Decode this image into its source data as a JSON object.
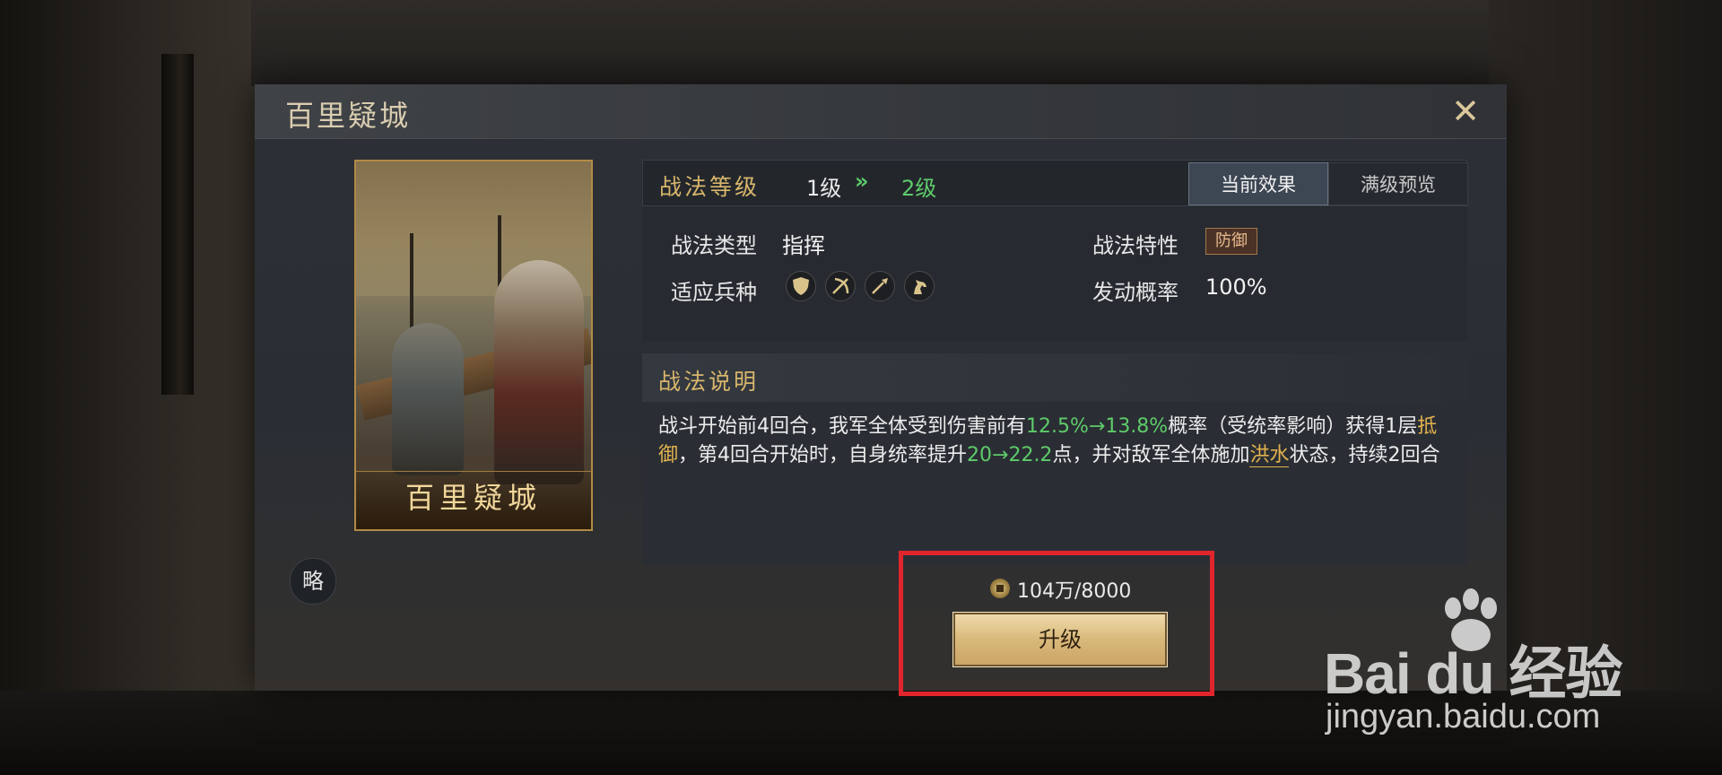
{
  "dialog": {
    "title": "百里疑城",
    "close_icon": "close-x-icon"
  },
  "card": {
    "name": "百里疑城"
  },
  "abbr_button": "略",
  "level": {
    "label": "战法等级",
    "current": "1级",
    "arrow": "»",
    "next": "2级",
    "tabs": [
      {
        "label": "当前效果",
        "active": true
      },
      {
        "label": "满级预览",
        "active": false
      }
    ]
  },
  "attributes": {
    "type_label": "战法类型",
    "type_value": "指挥",
    "trait_label": "战法特性",
    "trait_value": "防御",
    "units_label": "适应兵种",
    "units": [
      "shield-icon",
      "bow-icon",
      "spear-icon",
      "horse-icon"
    ],
    "rate_label": "发动概率",
    "rate_value": "100%"
  },
  "description": {
    "title": "战法说明",
    "seg1": "战斗开始前4回合，我军全体受到伤害前有",
    "val1": "12.5%→13.8%",
    "seg2": "概率（受统率影响）获得1层",
    "kw1": "抵御",
    "seg3": "，第4回合开始时，自身统率提升",
    "val2": "20→22.2",
    "seg4": "点，并对敌军全体施加",
    "kw2": "洪水",
    "seg5": "状态，持续2回合"
  },
  "cost": {
    "icon": "coin-icon",
    "text": "104万/8000"
  },
  "upgrade_button": "升级",
  "watermark": {
    "logo": "Bai  du 经验",
    "url": "jingyan.baidu.com"
  },
  "colors": {
    "highlight_green": "#5ecb6a",
    "highlight_gold": "#e2b24d",
    "annotation_red": "#e0262c"
  }
}
